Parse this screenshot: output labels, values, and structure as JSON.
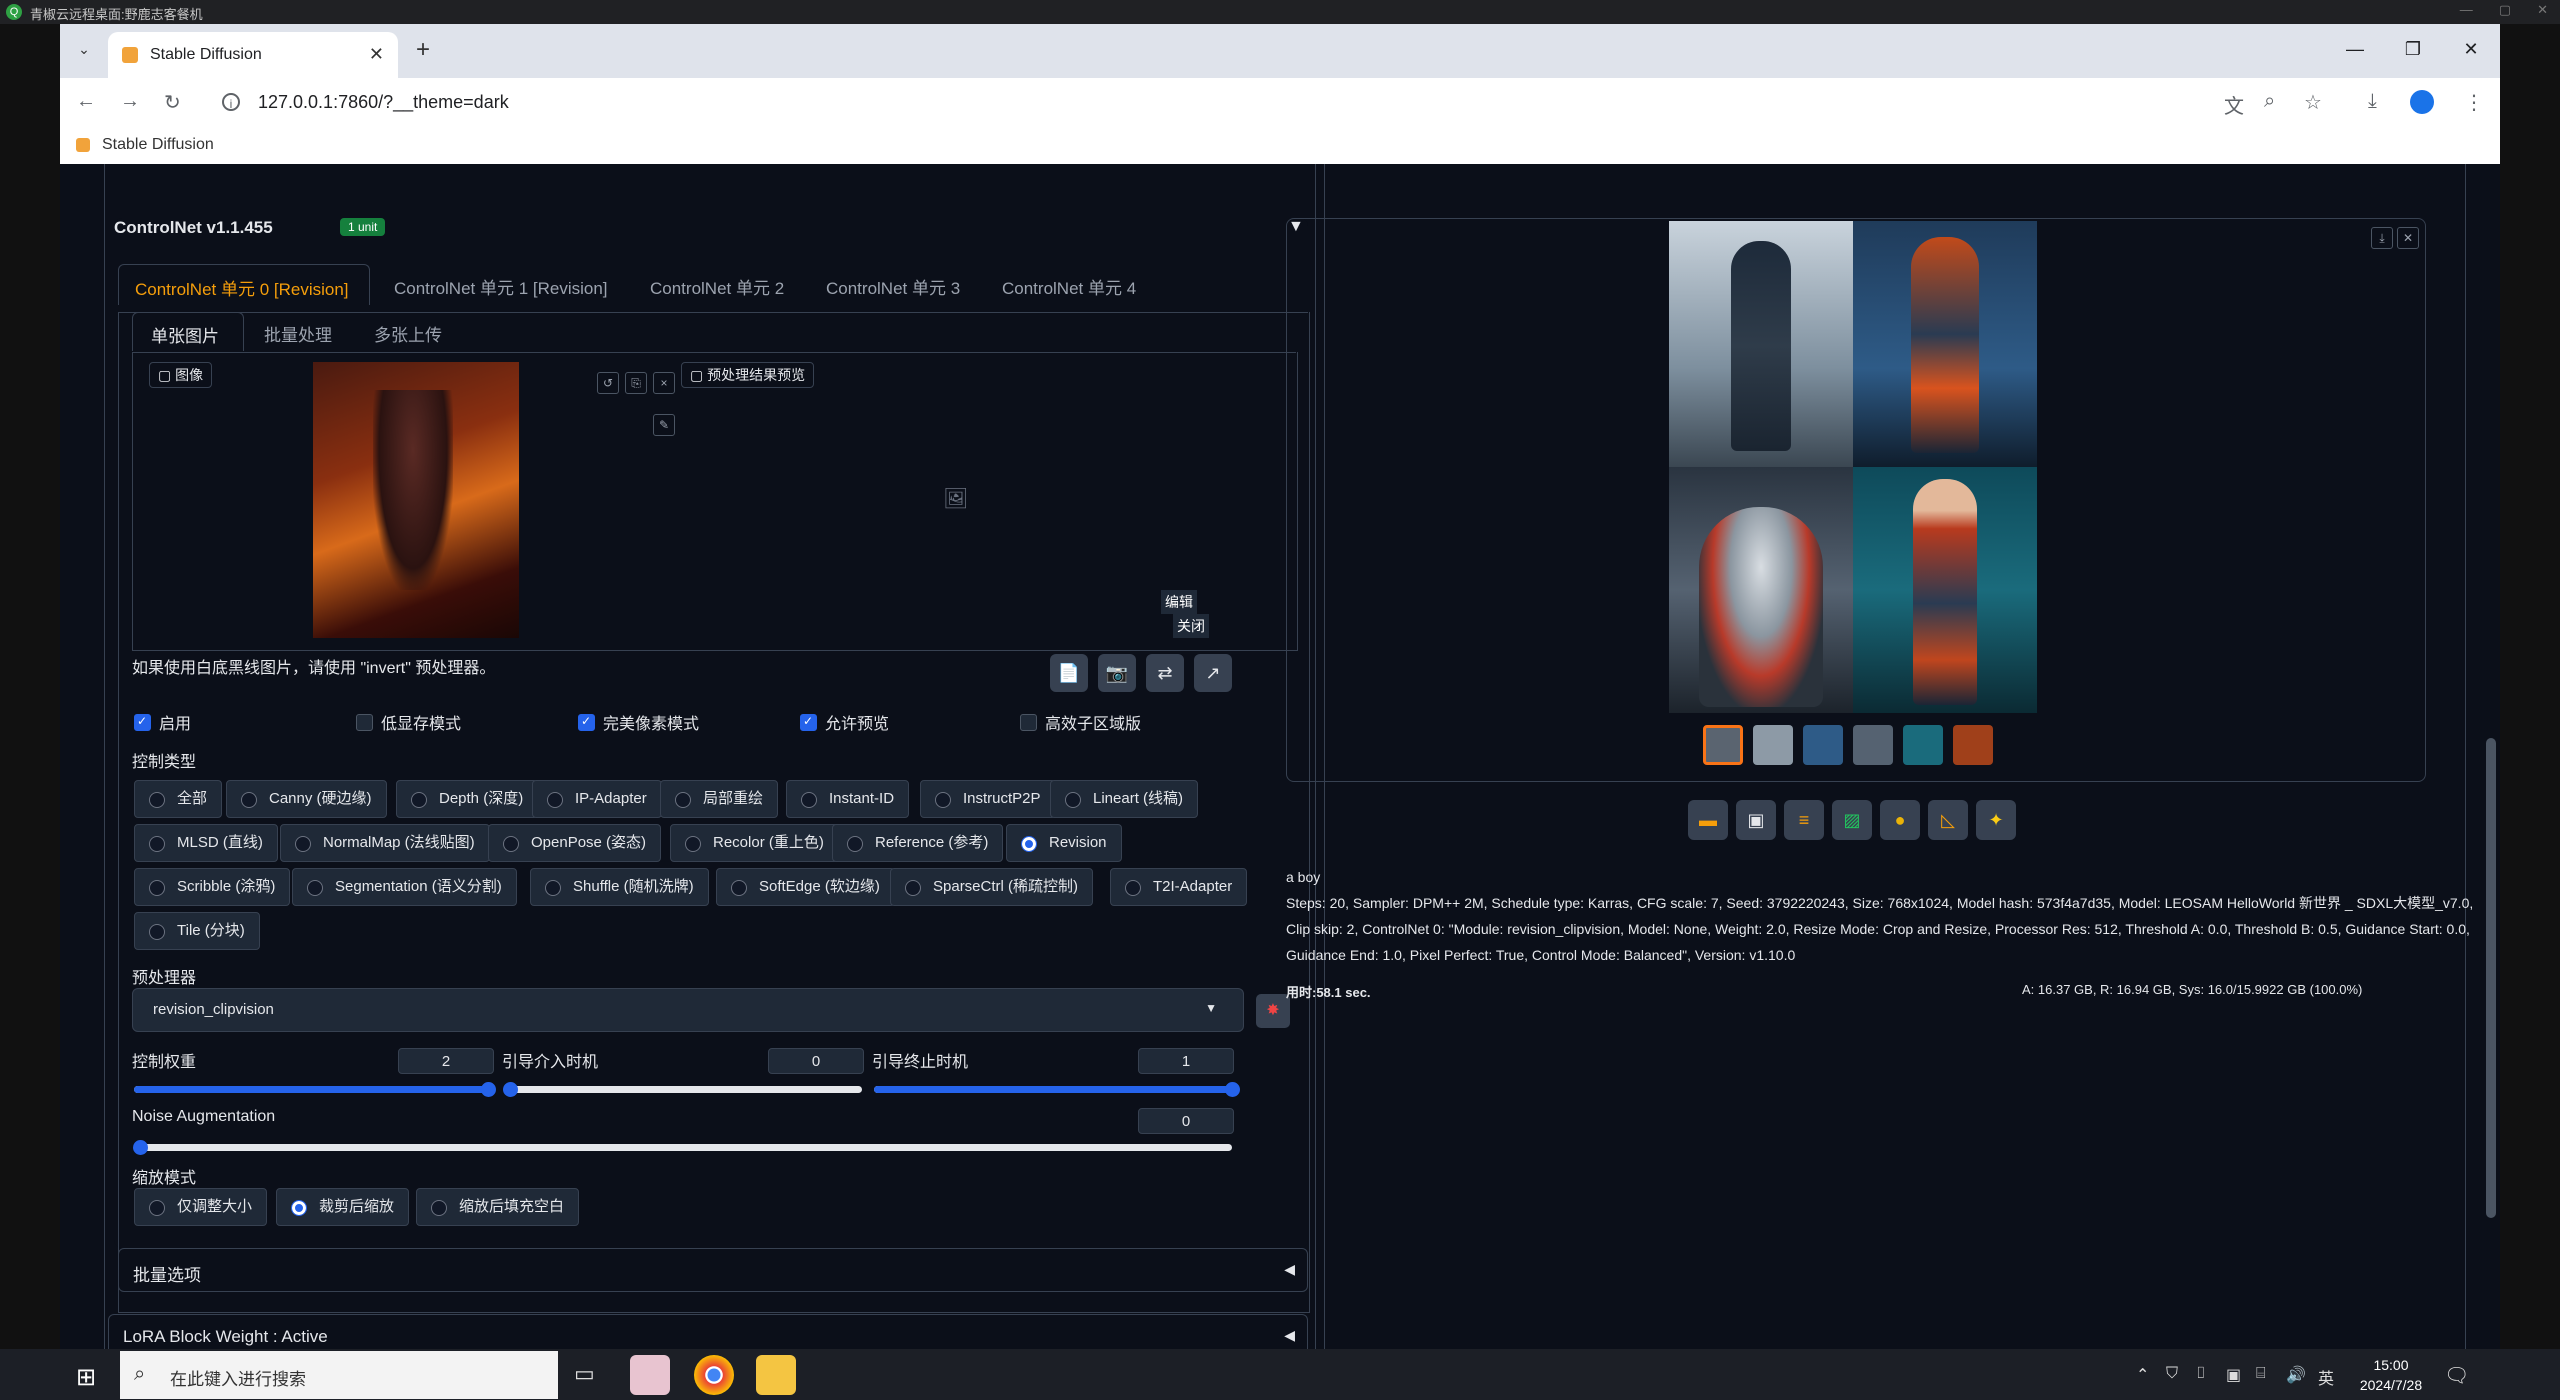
{
  "remote_desktop": {
    "title": "青椒云远程桌面:野鹿志客餐机",
    "controls": [
      "—",
      "▢",
      "✕"
    ]
  },
  "browser": {
    "tab_title": "Stable Diffusion",
    "new_tab": "+",
    "close_tab": "✕",
    "url": "127.0.0.1:7860/?__theme=dark",
    "bookmark": "Stable Diffusion",
    "window_controls": [
      "—",
      "❐",
      "✕"
    ]
  },
  "controlnet": {
    "title": "ControlNet v1.1.455",
    "badge": "1 unit",
    "collapse": "▼",
    "unit_tabs": [
      "ControlNet 单元 0 [Revision]",
      "ControlNet 单元 1 [Revision]",
      "ControlNet 单元 2",
      "ControlNet 单元 3",
      "ControlNet 单元 4"
    ],
    "input_tabs": [
      "单张图片",
      "批量处理",
      "多张上传"
    ],
    "image_label": "图像",
    "preview_label": "预处理结果预览",
    "edit_label": "编辑",
    "close_label": "关闭",
    "hint": "如果使用白底黑线图片，请使用 \"invert\" 预处理器。",
    "checkboxes": [
      {
        "label": "启用",
        "checked": true
      },
      {
        "label": "低显存模式",
        "checked": false
      },
      {
        "label": "完美像素模式",
        "checked": true
      },
      {
        "label": "允许预览",
        "checked": true
      },
      {
        "label": "高效子区域版",
        "checked": false
      }
    ],
    "control_type_label": "控制类型",
    "control_types": [
      "全部",
      "Canny (硬边缘)",
      "Depth (深度)",
      "IP-Adapter",
      "局部重绘",
      "Instant-ID",
      "InstructP2P",
      "Lineart (线稿)",
      "MLSD (直线)",
      "NormalMap (法线贴图)",
      "OpenPose (姿态)",
      "Recolor (重上色)",
      "Reference (参考)",
      "Revision",
      "Scribble (涂鸦)",
      "Segmentation (语义分割)",
      "Shuffle (随机洗牌)",
      "SoftEdge (软边缘)",
      "SparseCtrl (稀疏控制)",
      "T2I-Adapter",
      "Tile (分块)"
    ],
    "selected_control_type": "Revision",
    "preprocessor_label": "预处理器",
    "preprocessor_value": "revision_clipvision",
    "weight_label": "控制权重",
    "weight_value": "2",
    "weight_level": 1.0,
    "start_label": "引导介入时机",
    "start_value": "0",
    "end_label": "引导终止时机",
    "end_value": "1",
    "noise_label": "Noise Augmentation",
    "noise_value": "0",
    "resize_label": "缩放模式",
    "resize_modes": [
      "仅调整大小",
      "裁剪后缩放",
      "缩放后填充空白"
    ],
    "selected_resize": "裁剪后缩放",
    "batch_options": "批量选项",
    "expand_arrow": "◀"
  },
  "lora": {
    "title": "LoRA Block Weight : Active",
    "arrow": "◀"
  },
  "output": {
    "prompt": "a boy",
    "params": "Steps: 20, Sampler: DPM++ 2M, Schedule type: Karras, CFG scale: 7, Seed: 3792220243, Size: 768x1024, Model hash: 573f4a7d35, Model: LEOSAM HelloWorld 新世界 _ SDXL大模型_v7.0, Clip skip: 2, ControlNet 0: \"Module: revision_clipvision, Model: None, Weight: 2.0, Resize Mode: Crop and Resize, Processor Res: 512, Threshold A: 0.0, Threshold B: 0.5, Guidance Start: 0.0, Guidance End: 1.0, Pixel Perfect: True, Control Mode: Balanced\", Version: v1.10.0",
    "time": "用时:58.1 sec.",
    "memory": "A: 16.37 GB, R: 16.94 GB, Sys: 16.0/15.9922 GB (100.0%)",
    "tool_icons": [
      "folder-icon",
      "save-icon",
      "zip-icon",
      "image-icon",
      "palette-icon",
      "ruler-icon",
      "sparkle-icon"
    ]
  },
  "taskbar": {
    "search_placeholder": "在此键入进行搜索",
    "ime": "英",
    "time": "15:00",
    "date": "2024/7/28"
  }
}
